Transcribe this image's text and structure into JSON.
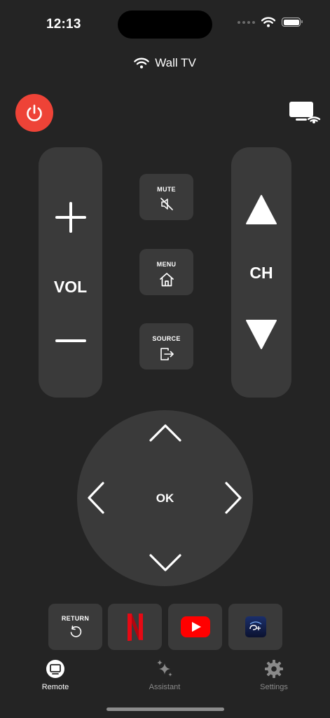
{
  "status_bar": {
    "time": "12:13"
  },
  "header": {
    "device_name": "Wall TV"
  },
  "remote": {
    "volume_label": "VOL",
    "channel_label": "CH",
    "mute_label": "MUTE",
    "menu_label": "MENU",
    "source_label": "SOURCE",
    "ok_label": "OK",
    "return_label": "RETURN"
  },
  "apps": [
    {
      "icon": "netflix-icon"
    },
    {
      "icon": "youtube-icon"
    },
    {
      "icon": "disney-plus-icon"
    }
  ],
  "tabs": [
    {
      "label": "Remote",
      "icon": "tv-icon",
      "active": true
    },
    {
      "label": "Assistant",
      "icon": "sparkles-icon",
      "active": false
    },
    {
      "label": "Settings",
      "icon": "gear-icon",
      "active": false
    }
  ],
  "colors": {
    "background": "#242424",
    "panel": "#3a3a3a",
    "power": "#ee4337",
    "netflix": "#e50914",
    "youtube": "#ff0000"
  }
}
